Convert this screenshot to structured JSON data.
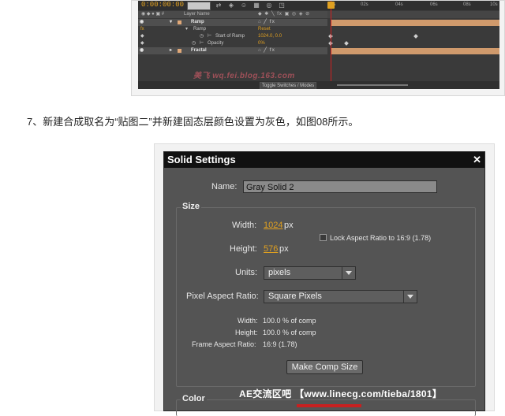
{
  "timeline": {
    "timecode": "0:00:00:00",
    "ruler_ticks": [
      "0s",
      "02s",
      "04s",
      "06s",
      "08s",
      "10s"
    ],
    "header": {
      "layer_name_col": "Layer Name"
    },
    "rows": [
      {
        "kind": "layer",
        "name": "Ramp",
        "swatch": "#e0a878"
      },
      {
        "kind": "effect",
        "name": "Ramp",
        "value": "Reset"
      },
      {
        "kind": "property",
        "name": "Start of Ramp",
        "value": "1024.0, 0.0"
      },
      {
        "kind": "property",
        "name": "Opacity",
        "value": "0%"
      },
      {
        "kind": "layer",
        "name": "Fractal",
        "swatch": "#e0a878"
      }
    ],
    "footer_toggle": "Toggle Switches / Modes",
    "watermark": "美飞 wq.fei.blog.163.com"
  },
  "caption": "7、新建合成取名为“贴图二”并新建固态层颜色设置为灰色，如图08所示。",
  "dialog": {
    "title": "Solid Settings",
    "close_glyph": "✕",
    "name_label": "Name:",
    "name_value": "Gray Solid 2",
    "size_group": "Size",
    "width_label": "Width:",
    "width_value": "1024",
    "height_label": "Height:",
    "height_value": "576",
    "unit_px": "px",
    "lock_aspect_label": "Lock Aspect Ratio to 16:9 (1.78)",
    "units_label": "Units:",
    "units_value": "pixels",
    "par_label": "Pixel Aspect Ratio:",
    "par_value": "Square Pixels",
    "info_width_label": "Width:",
    "info_width_value": "100.0 % of comp",
    "info_height_label": "Height:",
    "info_height_value": "100.0 % of comp",
    "info_far_label": "Frame Aspect Ratio:",
    "info_far_value": "16:9 (1.78)",
    "make_comp_size": "Make Comp Size",
    "color_group": "Color"
  },
  "watermark_bottom": "AE交流区吧 【www.linecg.com/tieba/1801】",
  "colors": {
    "accent": "#e0a020",
    "layer_bar": "#d09a6c",
    "playhead": "#d02020"
  }
}
